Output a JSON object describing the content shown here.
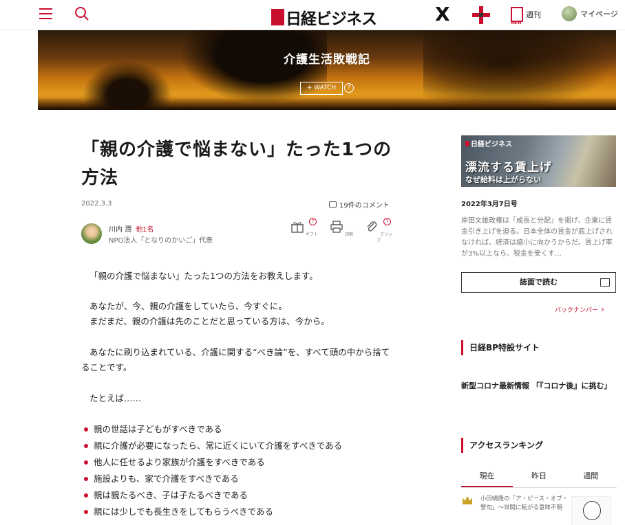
{
  "header": {
    "logo_text": "日経ビジネス",
    "x_label": "X",
    "weekly_label": "週刊",
    "weekly_badge": "NEW",
    "mypage_label": "マイページ"
  },
  "hero": {
    "series_title": "介護生活敗戦記",
    "watch_label": "+ WATCH",
    "help_glyph": "?"
  },
  "article": {
    "title": "「親の介護で悩まない」たった1つの方法",
    "date": "2022.3.3",
    "comments": "19件のコメント",
    "author": {
      "name": "川内 潤",
      "others": "他1名",
      "org": "NPO法人「となりのかいご」代表"
    },
    "tools": [
      {
        "label": "ギフト"
      },
      {
        "label": "印刷"
      },
      {
        "label": "クリップ"
      }
    ],
    "paragraphs": [
      "「親の介護で悩まない」たった1つの方法をお教えします。",
      "あなたが、今、親の介護をしていたら、今すぐに。",
      "まだまだ、親の介護は先のことだと思っている方は、今から。",
      "あなたに刷り込まれている、介護に関する“べき論”を、すべて頭の中から捨てることです。",
      "たとえば……"
    ],
    "bullets": [
      "親の世話は子どもがすべきである",
      "親に介護が必要になったら、常に近くにいて介護をすべきである",
      "他人に任せるより家族が介護をすべきである",
      "施設よりも、家で介護をすべきである",
      "親は親たるべき、子は子たるべきである",
      "親には少しでも長生きをしてもらうべきである"
    ]
  },
  "sidebar": {
    "magazine": {
      "logo": "日経ビジネス",
      "headline": "漂流する賃上げ",
      "subhead": "なぜ給料は上がらない",
      "date": "2022年3月7日号",
      "description": "岸田文雄政権は「成長と分配」を掲げ、企業に賃金引き上げを迫る。日本全体の賃金が底上げされなければ、経済は縮小に向かうからだ。賃上げ率が3%以上なら、税金を安くす…",
      "read_button": "誌面で読む",
      "backnumber": "バックナンバー"
    },
    "special_head": "日経BP特設サイト",
    "special_link": "新型コロナ最新情報 「『コロナ後』に挑む」",
    "ranking_head": "アクセスランキング",
    "ranking_tabs": [
      "現在",
      "昨日",
      "週間"
    ],
    "ranking_first": "小田嶋隆の「ア・ピース・オブ・警句」〜世間に転がる意味不明"
  }
}
